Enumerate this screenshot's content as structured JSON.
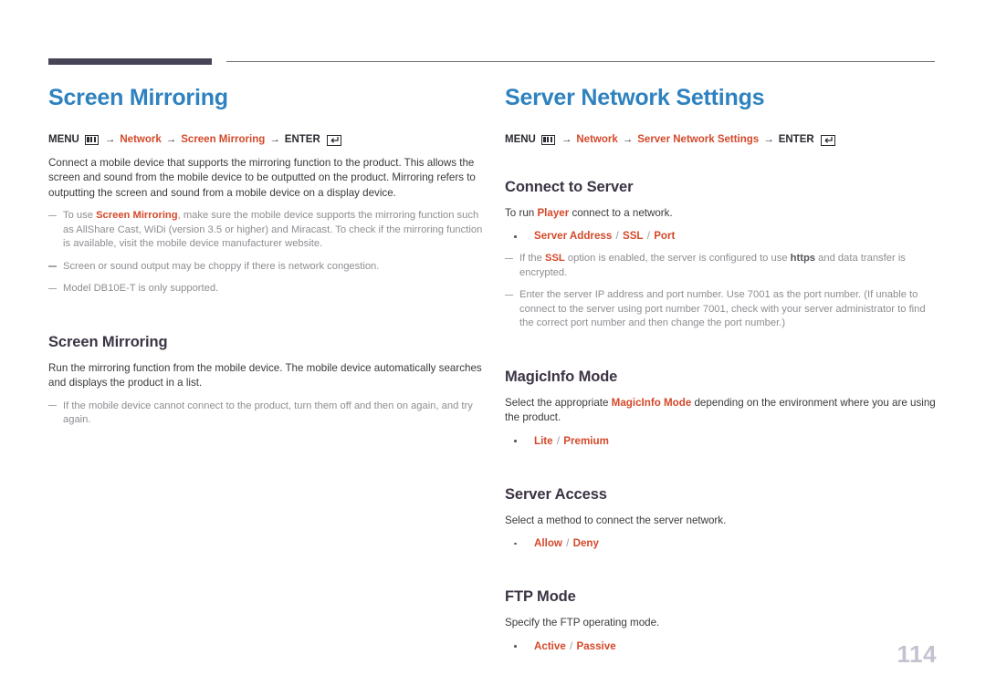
{
  "page": {
    "number": "114"
  },
  "left_column": {
    "title": "Screen Mirroring",
    "menu_path": {
      "menu_label": "MENU",
      "menu_icon": "menu-grid-icon",
      "arrow": "→",
      "step1": "Network",
      "step2": "Screen Mirroring",
      "enter_label": "ENTER",
      "enter_icon": "enter-return-icon"
    },
    "intro": "Connect a mobile device that supports the mirroring function to the product. This allows the screen and sound from the mobile device to be outputted on the product. Mirroring refers to outputting the screen and sound from a mobile device on a display device.",
    "notes": [
      {
        "pre": "To use ",
        "accent": "Screen Mirroring",
        "post": ", make sure the mobile device supports the mirroring function such as AllShare Cast, WiDi (version 3.5 or higher) and Miracast. To check if the mirroring function is available, visit the mobile device manufacturer website."
      },
      {
        "pre": "Screen or sound output may be choppy if there is network congestion.",
        "accent": "",
        "post": ""
      },
      {
        "pre": "Model DB10E-T is only supported.",
        "accent": "",
        "post": ""
      }
    ],
    "section": {
      "heading": "Screen Mirroring",
      "body": "Run the mirroring function from the mobile device. The mobile device automatically searches and displays the product in a list.",
      "note": "If the mobile device cannot connect to the product, turn them off and then on again, and try again."
    }
  },
  "right_column": {
    "title": "Server Network Settings",
    "menu_path": {
      "menu_label": "MENU",
      "menu_icon": "menu-grid-icon",
      "arrow": "→",
      "step1": "Network",
      "step2": "Server Network Settings",
      "enter_label": "ENTER",
      "enter_icon": "enter-return-icon"
    },
    "sections": [
      {
        "heading": "Connect to Server",
        "body_pre": "To run ",
        "body_accent": "Player",
        "body_post": " connect to a network.",
        "options": [
          "Server Address",
          "SSL",
          "Port"
        ],
        "notes": [
          {
            "pre": "If the ",
            "accent": "SSL",
            "mid": " option is enabled, the server is configured to use ",
            "bold": "https",
            "post": " and data transfer is encrypted."
          },
          {
            "pre": "Enter the server IP address and port number. Use 7001 as the port number. (If unable to connect to the server using port number 7001, check with your server administrator to find the correct port number and then change the port number.)",
            "accent": "",
            "mid": "",
            "bold": "",
            "post": ""
          }
        ]
      },
      {
        "heading": "MagicInfo Mode",
        "body_pre": "Select the appropriate ",
        "body_accent": "MagicInfo Mode",
        "body_post": " depending on the environment where you are using the product.",
        "options": [
          "Lite",
          "Premium"
        ],
        "notes": []
      },
      {
        "heading": "Server Access",
        "body_pre": "Select a method to connect the server network.",
        "body_accent": "",
        "body_post": "",
        "options": [
          "Allow",
          "Deny"
        ],
        "notes": []
      },
      {
        "heading": "FTP Mode",
        "body_pre": "Specify the FTP operating mode.",
        "body_accent": "",
        "body_post": "",
        "options": [
          "Active",
          "Passive"
        ],
        "notes": []
      }
    ]
  },
  "colors": {
    "title_blue": "#2e82bf",
    "accent_red": "#d4492a",
    "heading_dark": "#3c3444",
    "body_gray": "#3a3a3a",
    "note_gray": "#8e8e93",
    "rule_dark": "#474455",
    "page_number": "#c3c3d0"
  }
}
